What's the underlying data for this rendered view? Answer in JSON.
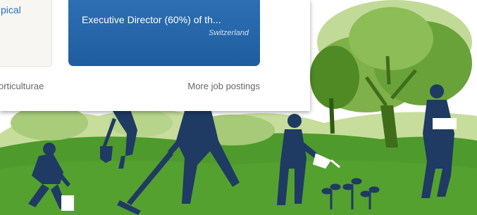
{
  "left_card": {
    "text": "pical"
  },
  "left_caption": "orticulturae",
  "job_card": {
    "title": "Executive Director (60%) of th...",
    "location": "Switzerland"
  },
  "more_link": "More job postings",
  "colors": {
    "ground": "#4f9a2c",
    "tree_dark": "#3f7a1e",
    "tree_light": "#a9cc7b",
    "figure": "#1f3a63",
    "card_blue": "#2d6fb3"
  }
}
